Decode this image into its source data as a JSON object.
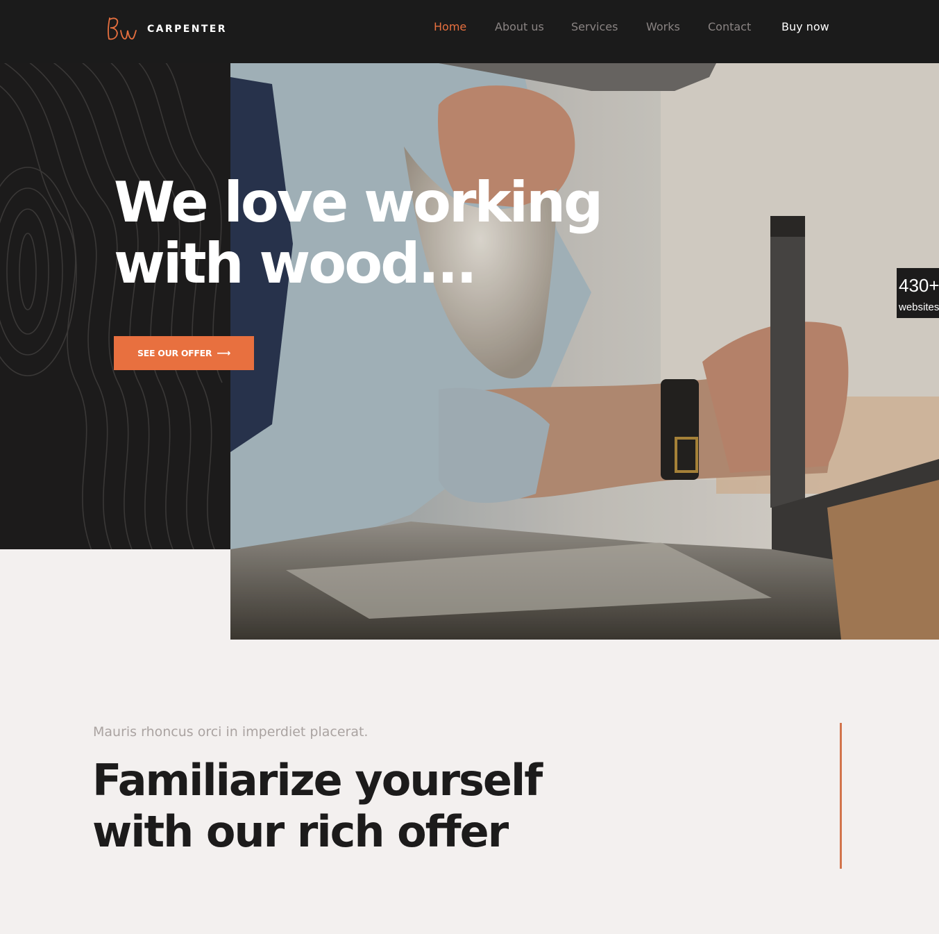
{
  "brand": {
    "logo_icon": "script-monogram-logo",
    "name": "CARPENTER"
  },
  "nav": {
    "items": [
      {
        "label": "Home",
        "active": true
      },
      {
        "label": "About us",
        "active": false
      },
      {
        "label": "Services",
        "active": false
      },
      {
        "label": "Works",
        "active": false
      },
      {
        "label": "Contact",
        "active": false
      }
    ],
    "buy_label": "Buy now"
  },
  "hero": {
    "title_line1": "We love working",
    "title_line2": "with wood...",
    "cta_label": "SEE OUR OFFER",
    "cta_icon": "long-arrow-right-icon",
    "image": "bearded-carpenter-at-table-saw-photo"
  },
  "badge": {
    "count": "430+",
    "label": "websites"
  },
  "offer": {
    "kicker": "Mauris rhoncus orci in imperdiet placerat.",
    "title_line1": "Familiarize yourself",
    "title_line2": "with our rich offer"
  },
  "colors": {
    "accent": "#e8703f",
    "dark": "#1c1b1b",
    "background": "#f3f0ef",
    "nav_muted": "#8a8483"
  }
}
